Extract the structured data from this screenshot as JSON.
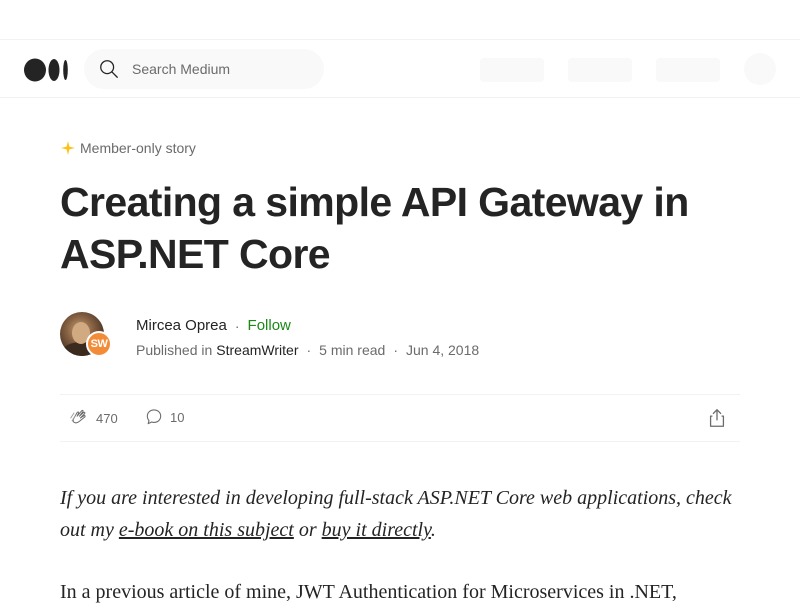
{
  "search": {
    "placeholder": "Search Medium"
  },
  "article": {
    "badge": "Member-only story",
    "title": "Creating a simple API Gateway in ASP.NET Core",
    "author": {
      "name": "Mircea Oprea",
      "follow": "Follow",
      "published_in_label": "Published in",
      "publication": "StreamWriter",
      "publication_badge": "SW",
      "read_time": "5 min read",
      "date": "Jun 4, 2018"
    },
    "actions": {
      "claps": "470",
      "responses": "10"
    },
    "intro": {
      "part1": "If you are interested in developing full-stack ASP.NET Core web applications, check out my ",
      "link1": "e-book on this subject",
      "part2": " or ",
      "link2": "buy it directly",
      "part3": "."
    },
    "paragraph2": "In a previous article of mine, JWT Authentication for Microservices in .NET,"
  },
  "colors": {
    "accent_follow": "#1a8917",
    "member_star": "#ffc017",
    "publication_badge": "#f28c38"
  }
}
